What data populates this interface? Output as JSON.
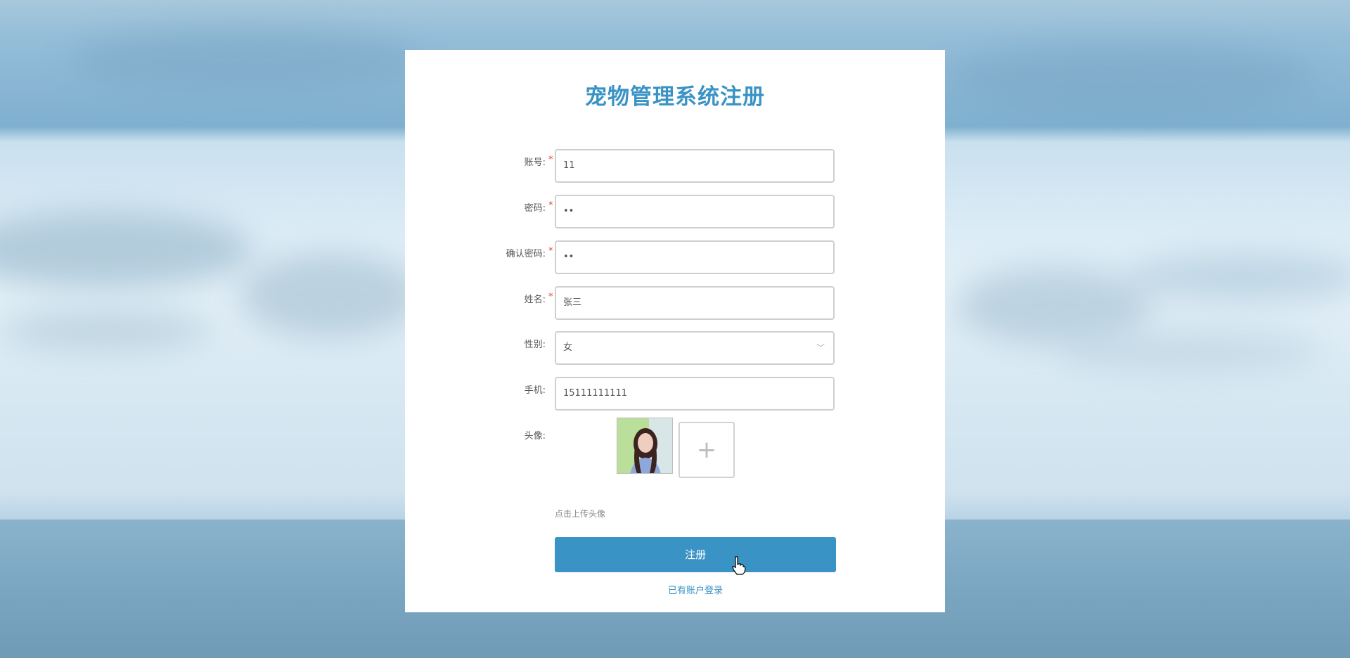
{
  "page": {
    "title": "宠物管理系统注册"
  },
  "form": {
    "fields": [
      {
        "label": "账号:",
        "required": true,
        "value": "11"
      },
      {
        "label": "密码:",
        "required": true,
        "value": "••"
      },
      {
        "label": "确认密码:",
        "required": true,
        "value": "••"
      },
      {
        "label": "姓名:",
        "required": true,
        "value": "张三"
      },
      {
        "label": "性别:",
        "required": false,
        "value": "女"
      },
      {
        "label": "手机:",
        "required": false,
        "value": "15111111111"
      }
    ],
    "avatar_label": "头像:",
    "upload_icon": "+",
    "upload_hint": "点击上传头像",
    "submit_label": "注册",
    "login_link": "已有账户登录",
    "required_mark": "*",
    "select_chevron": "﹀"
  },
  "colors": {
    "accent": "#3a93c5",
    "required": "#e5453c"
  }
}
